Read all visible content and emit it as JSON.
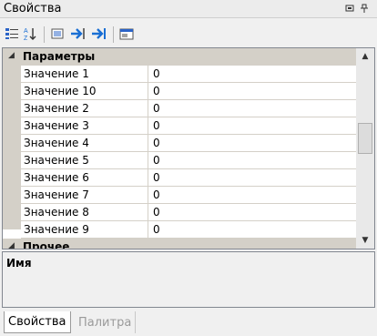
{
  "window": {
    "title": "Свойства",
    "buttons": [
      {
        "name": "window-position-icon",
        "glyph": "▫"
      },
      {
        "name": "pin-icon",
        "glyph": "⊥"
      }
    ]
  },
  "toolbar": {
    "buttons": [
      {
        "name": "categorized-view-icon",
        "glyph": "▤"
      },
      {
        "name": "sort-alphabetical-icon",
        "glyph": "A↓"
      },
      {
        "name": "properties-icon",
        "glyph": "▦"
      },
      {
        "name": "go-to-next-icon",
        "glyph": "➔"
      },
      {
        "name": "go-to-last-icon",
        "glyph": "⇥"
      },
      {
        "name": "property-pages-icon",
        "glyph": "▭"
      }
    ]
  },
  "grid": {
    "categories": [
      {
        "label": "Параметры",
        "rows": [
          {
            "name": "Значение 1",
            "value": "0"
          },
          {
            "name": "Значение 10",
            "value": "0"
          },
          {
            "name": "Значение 2",
            "value": "0"
          },
          {
            "name": "Значение 3",
            "value": "0"
          },
          {
            "name": "Значение 4",
            "value": "0"
          },
          {
            "name": "Значение 5",
            "value": "0"
          },
          {
            "name": "Значение 6",
            "value": "0"
          },
          {
            "name": "Значение 7",
            "value": "0"
          },
          {
            "name": "Значение 8",
            "value": "0"
          },
          {
            "name": "Значение 9",
            "value": "0"
          }
        ]
      },
      {
        "label": "Прочее",
        "rows": []
      }
    ]
  },
  "description": {
    "title": "Имя"
  },
  "tabs": [
    {
      "label": "Свойства",
      "active": true
    },
    {
      "label": "Палитра",
      "active": false
    }
  ],
  "colors": {
    "accent_blue": "#1a6fd4",
    "category_gray": "#d4d0c8"
  }
}
